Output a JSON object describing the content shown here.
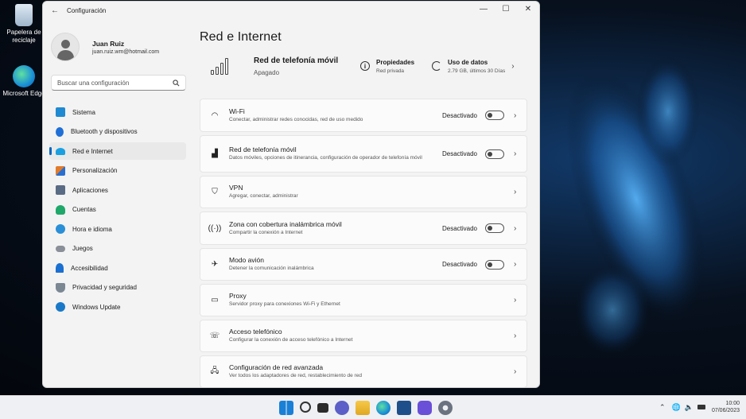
{
  "desktop": {
    "icons": [
      {
        "label": "Papelera de reciclaje",
        "icon": "recycle-bin-icon"
      },
      {
        "label": "Microsoft Edge",
        "icon": "edge-icon"
      }
    ]
  },
  "window": {
    "title": "Configuración",
    "controls": {
      "minimize": "—",
      "maximize": "☐",
      "close": "✕"
    }
  },
  "profile": {
    "name": "Juan Ruiz",
    "email": "juan.ruiz.wm@hotmail.com"
  },
  "search": {
    "placeholder": "Buscar una configuración"
  },
  "nav": {
    "items": [
      {
        "label": "Sistema",
        "icon": "monitor-icon",
        "color": "#1f8ad1"
      },
      {
        "label": "Bluetooth y dispositivos",
        "icon": "bluetooth-icon",
        "color": "#1f6fd6"
      },
      {
        "label": "Red e Internet",
        "icon": "wifi-icon",
        "color": "#1aa0e0"
      },
      {
        "label": "Personalización",
        "icon": "brush-icon",
        "color": "#e07b2c"
      },
      {
        "label": "Aplicaciones",
        "icon": "apps-icon",
        "color": "#5a6b85"
      },
      {
        "label": "Cuentas",
        "icon": "person-icon",
        "color": "#1fa86a"
      },
      {
        "label": "Hora e idioma",
        "icon": "globe-clock-icon",
        "color": "#2a8fd6"
      },
      {
        "label": "Juegos",
        "icon": "gamepad-icon",
        "color": "#8a8f99"
      },
      {
        "label": "Accesibilidad",
        "icon": "accessibility-icon",
        "color": "#1b6fd0"
      },
      {
        "label": "Privacidad y seguridad",
        "icon": "shield-icon",
        "color": "#7c8794"
      },
      {
        "label": "Windows Update",
        "icon": "update-icon",
        "color": "#1a78c8"
      }
    ]
  },
  "main": {
    "title": "Red e Internet",
    "hero": {
      "title": "Red de telefonía móvil",
      "subtitle": "Apagado",
      "properties": {
        "title": "Propiedades",
        "subtitle": "Red privada"
      },
      "usage": {
        "title": "Uso de datos",
        "subtitle": "2.79 GB, últimos 30 Días"
      }
    },
    "cards": [
      {
        "title": "Wi-Fi",
        "subtitle": "Conectar, administrar redes conocidas, red de uso medido",
        "state": "Desactivado",
        "icon": "wifi-icon"
      },
      {
        "title": "Red de telefonía móvil",
        "subtitle": "Datos móviles, opciones de itinerancia, configuración de operador de telefonía móvil",
        "state": "Desactivado",
        "icon": "cellular-icon"
      },
      {
        "title": "VPN",
        "subtitle": "Agregar, conectar, administrar",
        "state": "",
        "icon": "vpn-shield-icon"
      },
      {
        "title": "Zona con cobertura inalámbrica móvil",
        "subtitle": "Compartir la conexión a Internet",
        "state": "Desactivado",
        "icon": "hotspot-icon"
      },
      {
        "title": "Modo avión",
        "subtitle": "Detener la comunicación inalámbrica",
        "state": "Desactivado",
        "icon": "airplane-icon"
      },
      {
        "title": "Proxy",
        "subtitle": "Servidor proxy para conexiones Wi-Fi y Ethernet",
        "state": "",
        "icon": "proxy-icon"
      },
      {
        "title": "Acceso telefónico",
        "subtitle": "Configurar la conexión de acceso telefónico a Internet",
        "state": "",
        "icon": "dialup-icon"
      },
      {
        "title": "Configuración de red avanzada",
        "subtitle": "Ver todos los adaptadores de red, restablecimiento de red",
        "state": "",
        "icon": "network-adapter-icon"
      }
    ]
  },
  "taskbar": {
    "icons": [
      "start-icon",
      "search-icon",
      "task-view-icon",
      "chat-icon",
      "file-explorer-icon",
      "edge-icon",
      "store-icon",
      "app-icon",
      "settings-icon"
    ],
    "tray": {
      "chevron": "⌃",
      "time": "10:00",
      "date": "07/06/2023"
    }
  }
}
